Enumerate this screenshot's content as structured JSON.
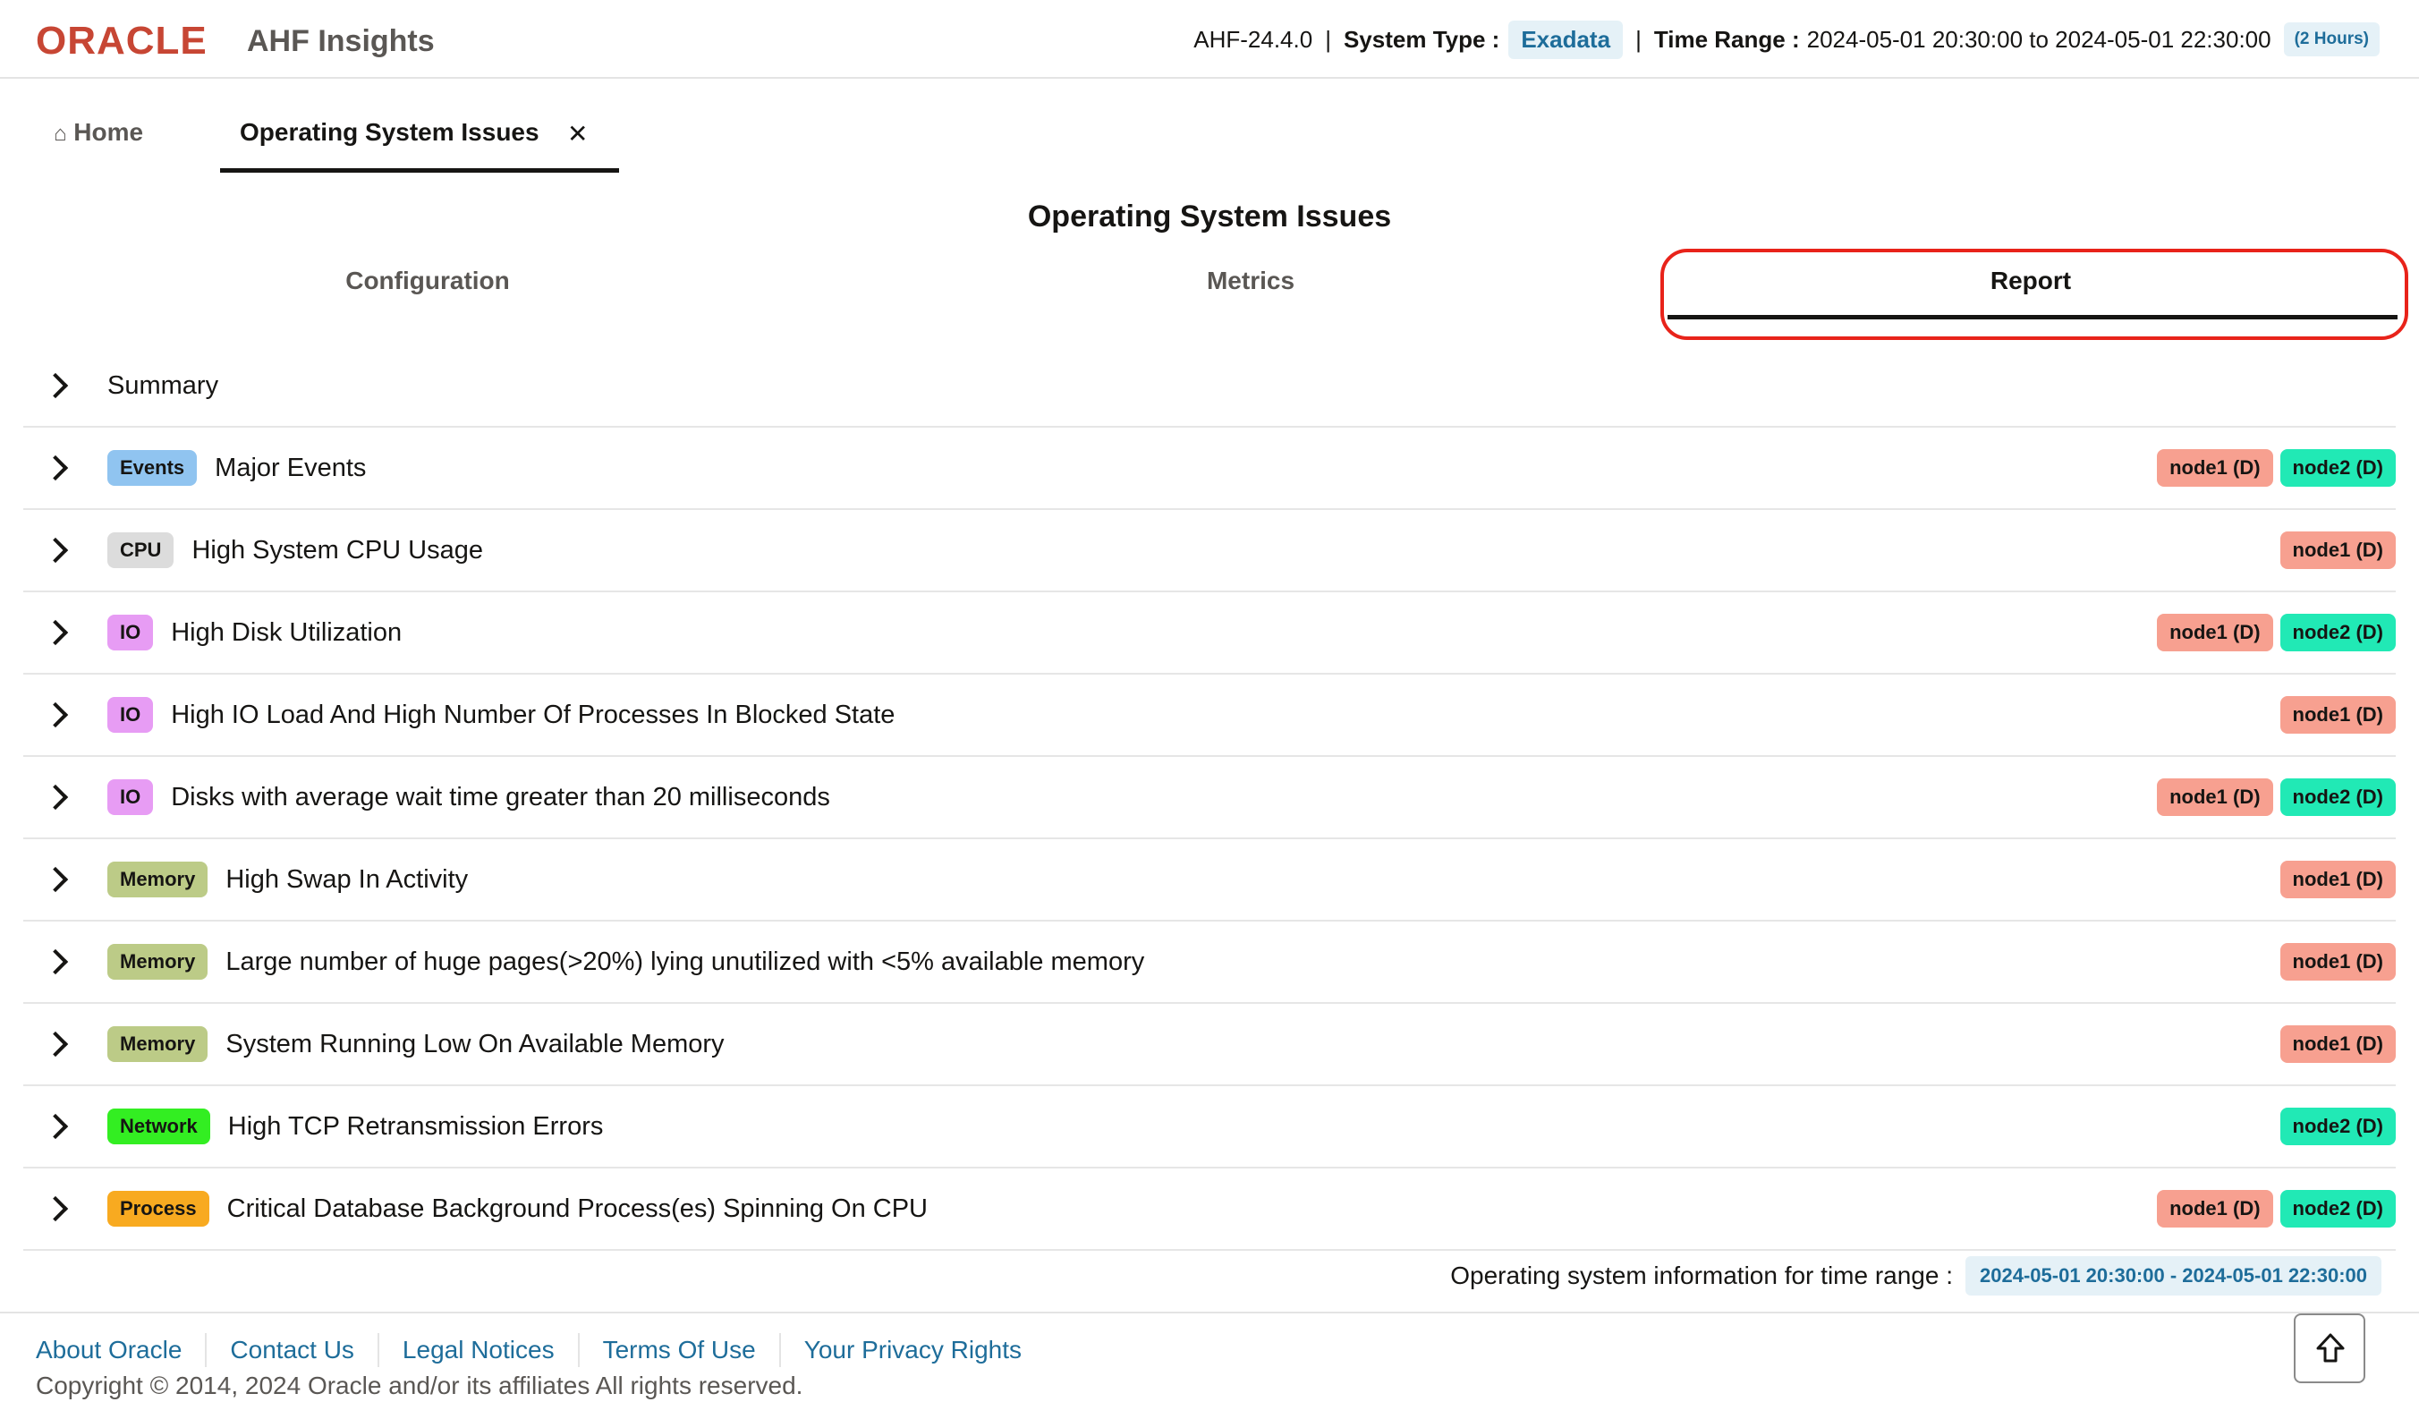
{
  "header": {
    "brand": "ORACLE",
    "app_name": "AHF Insights",
    "version": "AHF-24.4.0",
    "system_type_label": "System Type :",
    "system_type_value": "Exadata",
    "time_range_label": "Time Range :",
    "time_range_value": "2024-05-01 20:30:00 to 2024-05-01 22:30:00",
    "time_range_duration": "(2 Hours)"
  },
  "tabs": {
    "home_label": "Home",
    "active_label": "Operating System Issues"
  },
  "page": {
    "title": "Operating System Issues",
    "subtabs": [
      "Configuration",
      "Metrics",
      "Report"
    ],
    "active_subtab": "Report"
  },
  "report": {
    "summary_label": "Summary",
    "rows": [
      {
        "category": "Events",
        "title": "Major Events",
        "nodes": [
          "node1 (D)",
          "node2 (D)"
        ]
      },
      {
        "category": "CPU",
        "title": "High System CPU Usage",
        "nodes": [
          "node1 (D)"
        ]
      },
      {
        "category": "IO",
        "title": "High Disk Utilization",
        "nodes": [
          "node1 (D)",
          "node2 (D)"
        ]
      },
      {
        "category": "IO",
        "title": "High IO Load And High Number Of Processes In Blocked State",
        "nodes": [
          "node1 (D)"
        ]
      },
      {
        "category": "IO",
        "title": "Disks with average wait time greater than 20 milliseconds",
        "nodes": [
          "node1 (D)",
          "node2 (D)"
        ]
      },
      {
        "category": "Memory",
        "title": "High Swap In Activity",
        "nodes": [
          "node1 (D)"
        ]
      },
      {
        "category": "Memory",
        "title": "Large number of huge pages(>20%) lying unutilized with <5% available memory",
        "nodes": [
          "node1 (D)"
        ]
      },
      {
        "category": "Memory",
        "title": "System Running Low On Available Memory",
        "nodes": [
          "node1 (D)"
        ]
      },
      {
        "category": "Network",
        "title": "High TCP Retransmission Errors",
        "nodes": [
          "node2 (D)"
        ]
      },
      {
        "category": "Process",
        "title": "Critical Database Background Process(es) Spinning On CPU",
        "nodes": [
          "node1 (D)",
          "node2 (D)"
        ]
      }
    ],
    "range_label": "Operating system information for time range :",
    "range_value": "2024-05-01 20:30:00 - 2024-05-01 22:30:00"
  },
  "footer": {
    "links": [
      "About Oracle",
      "Contact Us",
      "Legal Notices",
      "Terms Of Use",
      "Your Privacy Rights"
    ],
    "copyright": "Copyright © 2014, 2024 Oracle and/or its affiliates All rights reserved."
  },
  "colors": {
    "brand_red": "#c74634",
    "link_blue": "#1e6d9a",
    "highlight_red": "#e8231a",
    "node1": "#f7a090",
    "node2": "#21e9b5",
    "events": "#90c4f0",
    "cpu": "#dcdcdc",
    "io": "#e79cf4",
    "memory": "#bccb87",
    "network": "#33ee22",
    "process": "#f8aa20"
  }
}
